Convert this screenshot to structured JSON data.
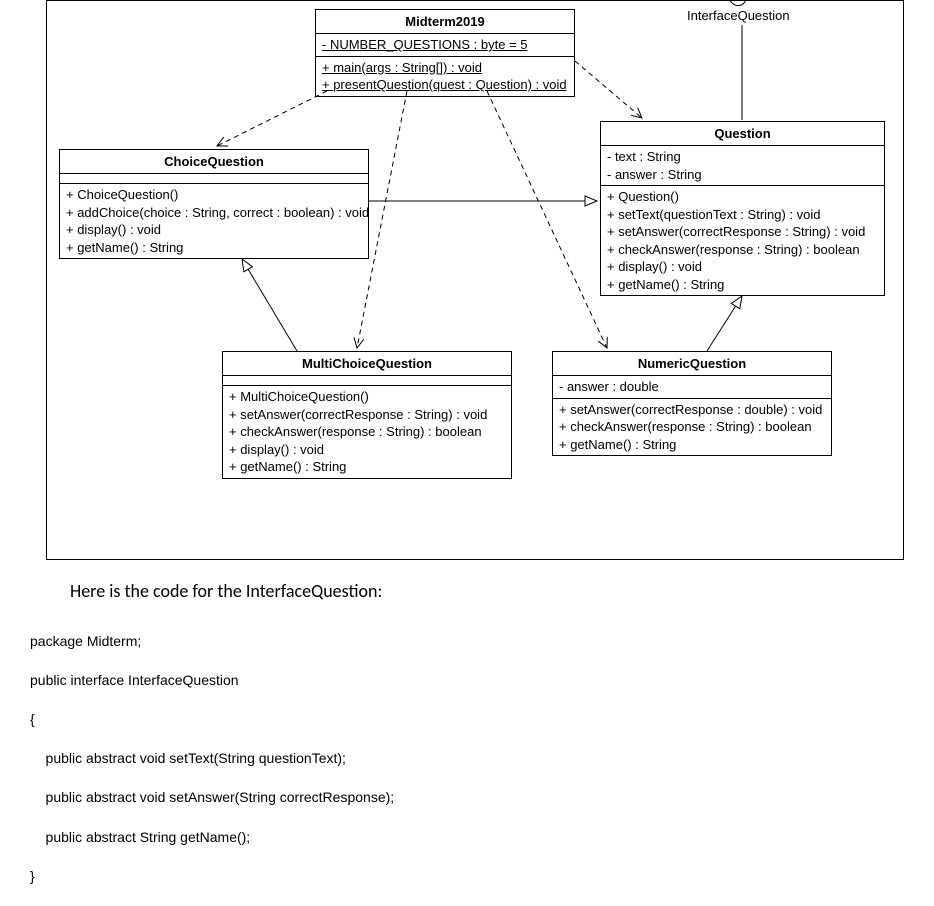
{
  "interface": {
    "name": "InterfaceQuestion"
  },
  "classes": {
    "midterm": {
      "name": "Midterm2019",
      "attributes": [
        "- NUMBER_QUESTIONS : byte = 5"
      ],
      "operations": [
        "+ main(args : String[]) : void",
        "+ presentQuestion(quest : Question) : void"
      ],
      "underline_ops": true
    },
    "choice": {
      "name": "ChoiceQuestion",
      "operations": [
        "+ ChoiceQuestion()",
        "+ addChoice(choice : String, correct : boolean) : void",
        "+ display() : void",
        "+ getName() : String"
      ]
    },
    "question": {
      "name": "Question",
      "attributes": [
        "- text : String",
        "- answer : String"
      ],
      "operations": [
        "+ Question()",
        "+ setText(questionText : String) : void",
        "+ setAnswer(correctResponse : String) : void",
        "+ checkAnswer(response : String) : boolean",
        "+ display() : void",
        "+ getName() : String"
      ]
    },
    "multi": {
      "name": "MultiChoiceQuestion",
      "operations": [
        "+ MultiChoiceQuestion()",
        "+ setAnswer(correctResponse : String) : void",
        "+ checkAnswer(response : String) : boolean",
        "+ display() : void",
        "+ getName() : String"
      ]
    },
    "numeric": {
      "name": "NumericQuestion",
      "attributes": [
        "- answer : double"
      ],
      "operations": [
        "+ setAnswer(correctResponse : double) : void",
        "+ checkAnswer(response : String) : boolean",
        "+ getName() : String"
      ]
    }
  },
  "caption": "Here is the code for the InterfaceQuestion:",
  "code_lines": [
    "package Midterm;",
    "public interface InterfaceQuestion",
    "{",
    "    public abstract void setText(String questionText);",
    "    public abstract void setAnswer(String correctResponse);",
    "    public abstract String getName();",
    "}"
  ],
  "relationships": [
    {
      "from": "Question",
      "to": "InterfaceQuestion",
      "type": "realization"
    },
    {
      "from": "ChoiceQuestion",
      "to": "Question",
      "type": "generalization"
    },
    {
      "from": "NumericQuestion",
      "to": "Question",
      "type": "generalization"
    },
    {
      "from": "MultiChoiceQuestion",
      "to": "ChoiceQuestion",
      "type": "generalization"
    },
    {
      "from": "Midterm2019",
      "to": "ChoiceQuestion",
      "type": "dependency"
    },
    {
      "from": "Midterm2019",
      "to": "Question",
      "type": "dependency"
    },
    {
      "from": "Midterm2019",
      "to": "MultiChoiceQuestion",
      "type": "dependency"
    },
    {
      "from": "Midterm2019",
      "to": "NumericQuestion",
      "type": "dependency"
    }
  ]
}
